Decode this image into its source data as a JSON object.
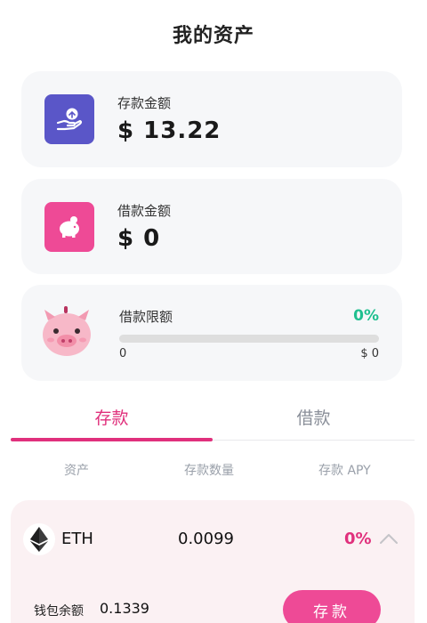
{
  "page": {
    "title": "我的资产"
  },
  "deposit": {
    "label": "存款金额",
    "value": "$ 13.22",
    "icon": "hand-coin-icon"
  },
  "borrow": {
    "label": "借款金额",
    "value": "$ 0",
    "icon": "piggy-bank-icon"
  },
  "limit": {
    "label": "借款限额",
    "percent": "0%",
    "progress": 0,
    "min": "0",
    "max": "$ 0"
  },
  "tabs": {
    "deposit": "存款",
    "borrow": "借款",
    "active": "deposit"
  },
  "columns": {
    "asset": "资产",
    "amount": "存款数量",
    "apy": "存款 APY"
  },
  "asset": {
    "symbol": "ETH",
    "amount": "0.0099",
    "apy": "0%",
    "wallet_label": "钱包余额",
    "wallet_value": "0.1339",
    "button": "存款"
  },
  "colors": {
    "accent": "#e0307c",
    "green": "#1fbf8f",
    "purple": "#5a56c8",
    "pink": "#ee4a96"
  }
}
